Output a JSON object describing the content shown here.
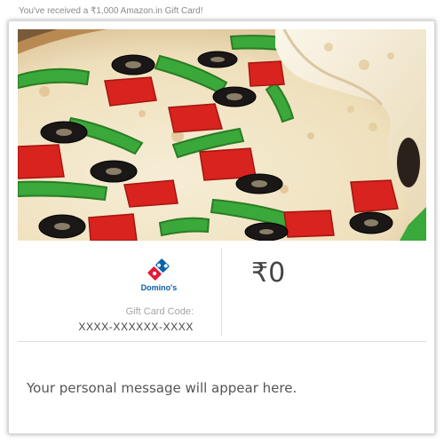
{
  "header": {
    "notice": "You've received a ₹1,000 Amazon.in Gift Card!"
  },
  "card": {
    "image_subject": "pizza-photo",
    "brand": {
      "logo_text": "Domino's",
      "colors": {
        "blue": "#0b64ac",
        "red": "#e31837",
        "white": "#ffffff"
      }
    },
    "code_label": "Gift Card Code:",
    "code_value": "XXXX-XXXXXX-XXXX",
    "amount": "₹0",
    "message": "Your personal message will appear here."
  }
}
